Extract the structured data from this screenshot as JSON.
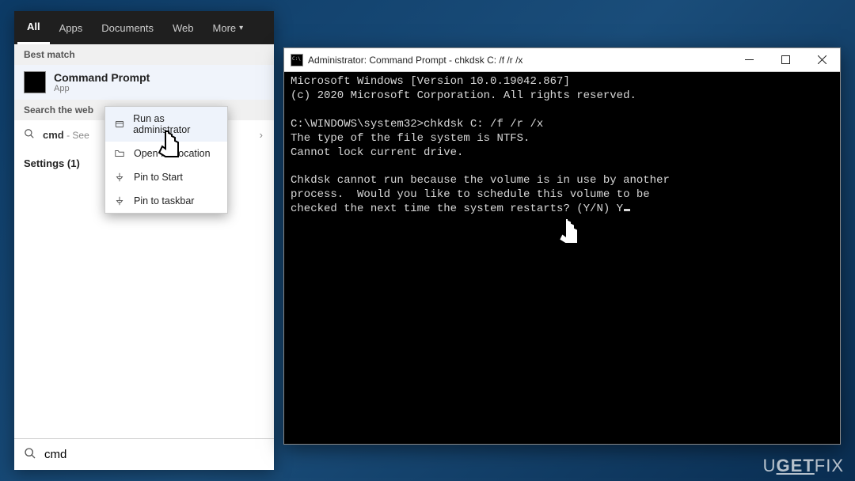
{
  "tabs": {
    "all": "All",
    "apps": "Apps",
    "documents": "Documents",
    "web": "Web",
    "more": "More"
  },
  "sections": {
    "best_match": "Best match",
    "search_web": "Search the web",
    "settings": "Settings (1)"
  },
  "best_match": {
    "title": "Command Prompt",
    "subtitle": "App"
  },
  "web_result": {
    "query": "cmd",
    "see": " - See "
  },
  "search_box": {
    "value": "cmd"
  },
  "context_menu": {
    "run_admin": "Run as administrator",
    "open_location": "Open file location",
    "pin_start": "Pin to Start",
    "pin_taskbar": "Pin to taskbar"
  },
  "cmd": {
    "title": "Administrator: Command Prompt - chkdsk  C: /f /r /x",
    "line1": "Microsoft Windows [Version 10.0.19042.867]",
    "line2": "(c) 2020 Microsoft Corporation. All rights reserved.",
    "prompt_line": "C:\\WINDOWS\\system32>chkdsk C: /f /r /x",
    "out1": "The type of the file system is NTFS.",
    "out2": "Cannot lock current drive.",
    "out3": "Chkdsk cannot run because the volume is in use by another",
    "out4": "process.  Would you like to schedule this volume to be",
    "out5": "checked the next time the system restarts? (Y/N) Y"
  },
  "brand": "UGETFIX"
}
